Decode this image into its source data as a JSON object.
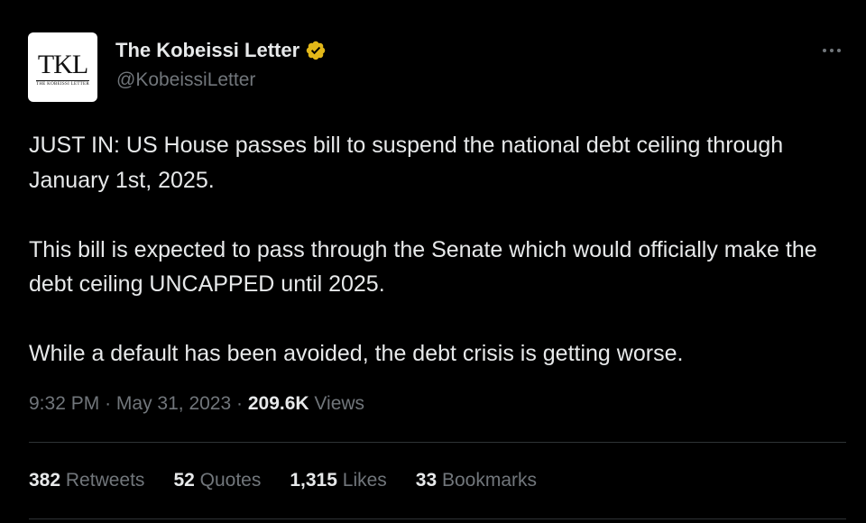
{
  "author": {
    "display_name": "The Kobeissi Letter",
    "handle": "@KobeissiLetter",
    "verified_icon": "verified-gold-badge-icon",
    "verified_color": "#e2b719",
    "avatar": {
      "monogram": "TKL",
      "subtitle": "THE KOBEISSI LETTER"
    }
  },
  "more_icon": "more-horizontal-icon",
  "tweet": {
    "paragraphs": [
      "JUST IN: US House passes bill to suspend the national debt ceiling through January 1st, 2025.",
      "This bill is expected to pass through the Senate which would officially make the debt ceiling UNCAPPED until 2025.",
      "While a default has been avoided, the debt crisis is getting worse."
    ]
  },
  "meta": {
    "time": "9:32 PM",
    "separator": "·",
    "date": "May 31, 2023",
    "views_count": "209.6K",
    "views_label": "Views"
  },
  "stats": [
    {
      "count": "382",
      "label": "Retweets"
    },
    {
      "count": "52",
      "label": "Quotes"
    },
    {
      "count": "1,315",
      "label": "Likes"
    },
    {
      "count": "33",
      "label": "Bookmarks"
    }
  ],
  "colors": {
    "background": "#000000",
    "text_primary": "#e7e9ea",
    "text_secondary": "#71767b",
    "divider": "#2f3336"
  }
}
